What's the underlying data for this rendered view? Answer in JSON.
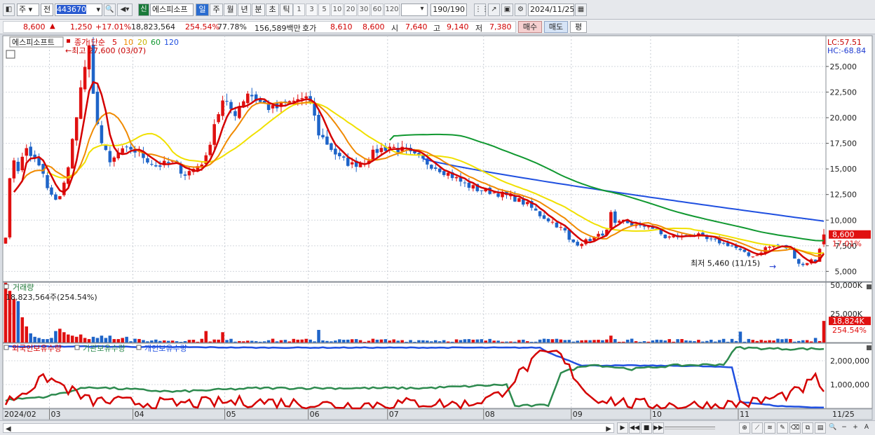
{
  "toolbar": {
    "market": "주",
    "period_btn": "전",
    "code": "443670",
    "badge_new": "신",
    "stock_name": "에스피소프",
    "periods": [
      "일",
      "주",
      "월",
      "년",
      "분",
      "초",
      "틱"
    ],
    "active_period": "일",
    "intervals": [
      "1",
      "3",
      "5",
      "10",
      "20",
      "30",
      "60",
      "120"
    ],
    "count": "190/190",
    "date": "2024/11/25"
  },
  "info": {
    "price": "8,600",
    "up_arrow": "▲",
    "change": "1,250",
    "change_pct": "+17.01%",
    "volume": "18,823,564",
    "volume_ratio": "254.54%",
    "turnover": "77.78%",
    "amount": "156,589백만",
    "quote_label": "호가",
    "ask": "8,610",
    "bid": "8,600",
    "open_label": "시",
    "open": "7,640",
    "high_label": "고",
    "high": "9,140",
    "low_label": "저",
    "low": "7,380",
    "buy_btn": "매수",
    "sell_btn": "매도",
    "avg_btn": "평"
  },
  "legend": {
    "name_tag": "에스피소프트",
    "ma_label": "종가 단순",
    "ma5": "5",
    "ma10": "10",
    "ma20": "20",
    "ma60": "60",
    "ma120": "120",
    "max_note": "최고 27,600 (03/07)",
    "min_note": "최저 5,460 (11/15)",
    "lc": "LC:57.51",
    "hc": "HC:-68.84",
    "last_price": "8,600",
    "last_pct": "17.01%"
  },
  "volume_panel": {
    "title": "거래량",
    "value_text": "18,823,564주(254.54%)",
    "axis": [
      "50,000K",
      "25,000K"
    ],
    "last_value": "18,824K",
    "last_pct": "254.54%"
  },
  "holding_panel": {
    "legend": [
      "외국인보유수량",
      "기관보유수량",
      "개인보유수량"
    ],
    "axis": [
      "2,000,000",
      "1,000,000"
    ]
  },
  "x_axis": {
    "first": "2024/02",
    "months": [
      "03",
      "04",
      "05",
      "06",
      "07",
      "08",
      "09",
      "10",
      "11"
    ],
    "end": "11/25"
  },
  "colors": {
    "up": "#e01010",
    "down": "#1e64c8",
    "ma5": "#d40000",
    "ma10": "#f08a00",
    "ma20": "#f0e000",
    "ma60": "#109830",
    "ma120": "#2050e0",
    "foreign": "#d40000",
    "institution": "#2d8a4e",
    "individual": "#2050e0"
  },
  "chart_data": {
    "type": "candlestick",
    "y_ticks": [
      25000,
      22500,
      20000,
      17500,
      15000,
      12500,
      10000,
      7500,
      5000
    ],
    "ylim": [
      4000,
      28000
    ],
    "anchors": [
      [
        0,
        8500
      ],
      [
        1,
        13800
      ],
      [
        2,
        16000
      ],
      [
        3,
        15000
      ],
      [
        5,
        17000
      ],
      [
        7,
        15800
      ],
      [
        9,
        14500
      ],
      [
        10,
        13000
      ],
      [
        12,
        11800
      ],
      [
        13,
        12500
      ],
      [
        15,
        15000
      ],
      [
        17,
        20500
      ],
      [
        19,
        25000
      ],
      [
        20,
        26500
      ],
      [
        21,
        22000
      ],
      [
        23,
        17500
      ],
      [
        25,
        15500
      ],
      [
        27,
        16500
      ],
      [
        30,
        17000
      ],
      [
        33,
        16200
      ],
      [
        36,
        15300
      ],
      [
        40,
        15600
      ],
      [
        43,
        14500
      ],
      [
        45,
        15000
      ],
      [
        48,
        16000
      ],
      [
        50,
        19500
      ],
      [
        52,
        21500
      ],
      [
        55,
        20500
      ],
      [
        58,
        22500
      ],
      [
        61,
        21500
      ],
      [
        64,
        20800
      ],
      [
        67,
        21300
      ],
      [
        70,
        21800
      ],
      [
        73,
        21500
      ],
      [
        75,
        18500
      ],
      [
        78,
        17000
      ],
      [
        80,
        16000
      ],
      [
        83,
        15400
      ],
      [
        86,
        15800
      ],
      [
        89,
        16800
      ],
      [
        92,
        17200
      ],
      [
        95,
        16800
      ],
      [
        98,
        16200
      ],
      [
        101,
        15600
      ],
      [
        104,
        15000
      ],
      [
        107,
        14300
      ],
      [
        110,
        13500
      ],
      [
        113,
        13000
      ],
      [
        116,
        12800
      ],
      [
        119,
        12500
      ],
      [
        122,
        12100
      ],
      [
        125,
        11500
      ],
      [
        128,
        10500
      ],
      [
        131,
        9800
      ],
      [
        134,
        8900
      ],
      [
        135,
        8000
      ],
      [
        137,
        7700
      ],
      [
        140,
        8100
      ],
      [
        142,
        8500
      ],
      [
        144,
        8900
      ],
      [
        145,
        10600
      ],
      [
        146,
        9500
      ],
      [
        148,
        9900
      ],
      [
        150,
        9600
      ],
      [
        152,
        9300
      ],
      [
        154,
        9500
      ],
      [
        156,
        8900
      ],
      [
        158,
        8300
      ],
      [
        160,
        8400
      ],
      [
        162,
        8400
      ],
      [
        164,
        8600
      ],
      [
        166,
        8500
      ],
      [
        168,
        8100
      ],
      [
        170,
        8000
      ],
      [
        172,
        7700
      ],
      [
        174,
        7500
      ],
      [
        176,
        7000
      ],
      [
        178,
        6500
      ],
      [
        180,
        6600
      ],
      [
        182,
        7300
      ],
      [
        184,
        7500
      ],
      [
        186,
        7400
      ],
      [
        188,
        7200
      ],
      [
        189,
        6400
      ],
      [
        190,
        5800
      ],
      [
        191,
        5600
      ],
      [
        192,
        5900
      ],
      [
        193,
        6100
      ],
      [
        194,
        6000
      ],
      [
        195,
        7300
      ],
      [
        196,
        8600
      ]
    ],
    "ma60_start": [
      92,
      17800
    ],
    "ma120_start": [
      100,
      16000
    ],
    "ma120_end": 9900,
    "volume_ylim": [
      0,
      50000000
    ],
    "volume_last": 18823564,
    "holding_ylim": [
      0,
      2500000
    ],
    "foreign_anchors": [
      [
        0,
        250000
      ],
      [
        10,
        1300000
      ],
      [
        20,
        320000
      ],
      [
        40,
        190000
      ],
      [
        60,
        300000
      ],
      [
        80,
        140000
      ],
      [
        100,
        240000
      ],
      [
        110,
        160000
      ],
      [
        118,
        550000
      ],
      [
        124,
        1600000
      ],
      [
        128,
        2200000
      ],
      [
        132,
        2350000
      ],
      [
        134,
        1900000
      ],
      [
        140,
        500000
      ],
      [
        150,
        180000
      ],
      [
        160,
        140000
      ],
      [
        170,
        120000
      ],
      [
        180,
        270000
      ],
      [
        190,
        700000
      ],
      [
        194,
        1250000
      ],
      [
        196,
        800000
      ]
    ],
    "institution_anchors": [
      [
        0,
        350000
      ],
      [
        10,
        500000
      ],
      [
        20,
        900000
      ],
      [
        40,
        700000
      ],
      [
        60,
        850000
      ],
      [
        80,
        850000
      ],
      [
        100,
        850000
      ],
      [
        110,
        920000
      ],
      [
        120,
        1000000
      ],
      [
        122,
        100000
      ],
      [
        130,
        130000
      ],
      [
        133,
        1500000
      ],
      [
        140,
        1850000
      ],
      [
        150,
        1650000
      ],
      [
        160,
        1800000
      ],
      [
        172,
        1850000
      ],
      [
        175,
        2550000
      ],
      [
        185,
        2500000
      ],
      [
        196,
        2500000
      ]
    ],
    "individual_anchors": [
      [
        0,
        2600000
      ],
      [
        20,
        2600000
      ],
      [
        60,
        2550000
      ],
      [
        100,
        2550000
      ],
      [
        128,
        2550000
      ],
      [
        130,
        2350000
      ],
      [
        138,
        1800000
      ],
      [
        150,
        1800000
      ],
      [
        165,
        1780000
      ],
      [
        174,
        1720000
      ],
      [
        176,
        280000
      ],
      [
        185,
        100000
      ],
      [
        196,
        30000
      ]
    ]
  }
}
